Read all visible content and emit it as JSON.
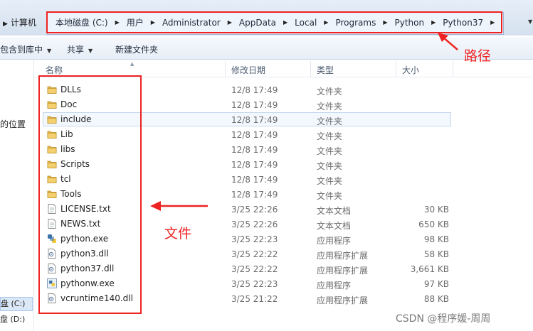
{
  "breadcrumb_left": {
    "label": "计算机"
  },
  "address": {
    "crumbs": [
      "本地磁盘 (C:)",
      "用户",
      "Administrator",
      "AppData",
      "Local",
      "Programs",
      "Python",
      "Python37"
    ]
  },
  "toolbar": {
    "organize_label": "包含到库中",
    "share_label": "共享",
    "new_folder_label": "新建文件夹"
  },
  "nav": {
    "recent_label": "的位置",
    "drive_c": "盘 (C:)",
    "drive_d": "盘 (D:)"
  },
  "columns": {
    "name": "名称",
    "modified": "修改日期",
    "type": "类型",
    "size": "大小"
  },
  "files": [
    {
      "name": "DLLs",
      "date": "12/8 17:49",
      "type": "文件夹",
      "size": "",
      "icon": "folder-icon"
    },
    {
      "name": "Doc",
      "date": "12/8 17:49",
      "type": "文件夹",
      "size": "",
      "icon": "folder-icon"
    },
    {
      "name": "include",
      "date": "12/8 17:49",
      "type": "文件夹",
      "size": "",
      "icon": "folder-icon"
    },
    {
      "name": "Lib",
      "date": "12/8 17:49",
      "type": "文件夹",
      "size": "",
      "icon": "folder-icon"
    },
    {
      "name": "libs",
      "date": "12/8 17:49",
      "type": "文件夹",
      "size": "",
      "icon": "folder-icon"
    },
    {
      "name": "Scripts",
      "date": "12/8 17:49",
      "type": "文件夹",
      "size": "",
      "icon": "folder-icon"
    },
    {
      "name": "tcl",
      "date": "12/8 17:49",
      "type": "文件夹",
      "size": "",
      "icon": "folder-icon"
    },
    {
      "name": "Tools",
      "date": "12/8 17:49",
      "type": "文件夹",
      "size": "",
      "icon": "folder-icon"
    },
    {
      "name": "LICENSE.txt",
      "date": "3/25 22:26",
      "type": "文本文档",
      "size": "30 KB",
      "icon": "text-file-icon"
    },
    {
      "name": "NEWS.txt",
      "date": "3/25 22:26",
      "type": "文本文档",
      "size": "650 KB",
      "icon": "text-file-icon"
    },
    {
      "name": "python.exe",
      "date": "3/25 22:23",
      "type": "应用程序",
      "size": "98 KB",
      "icon": "python-exe-icon"
    },
    {
      "name": "python3.dll",
      "date": "3/25 22:22",
      "type": "应用程序扩展",
      "size": "58 KB",
      "icon": "dll-file-icon"
    },
    {
      "name": "python37.dll",
      "date": "3/25 22:22",
      "type": "应用程序扩展",
      "size": "3,661 KB",
      "icon": "dll-file-icon"
    },
    {
      "name": "pythonw.exe",
      "date": "3/25 22:23",
      "type": "应用程序",
      "size": "97 KB",
      "icon": "pythonw-exe-icon"
    },
    {
      "name": "vcruntime140.dll",
      "date": "3/25 21:22",
      "type": "应用程序扩展",
      "size": "88 KB",
      "icon": "dll-file-icon"
    }
  ],
  "annotations": {
    "path_label": "路径",
    "files_label": "文件",
    "color": "#ee2222"
  },
  "watermark": "CSDN @程序媛-周周"
}
